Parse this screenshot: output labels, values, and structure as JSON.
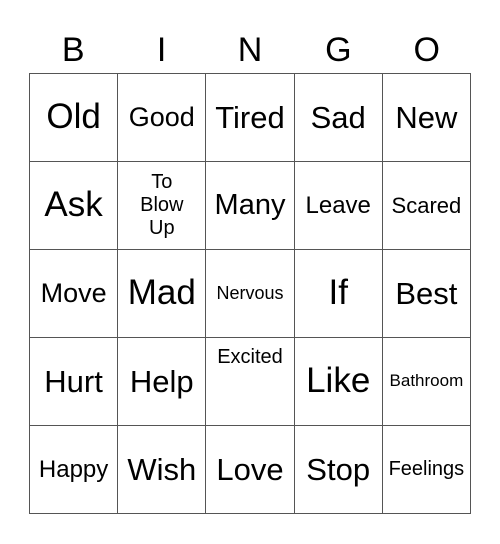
{
  "header": [
    "B",
    "I",
    "N",
    "G",
    "O"
  ],
  "cells": [
    [
      "Old",
      "Good",
      "Tired",
      "Sad",
      "New"
    ],
    [
      "Ask",
      "To\nBlow\nUp",
      "Many",
      "Leave",
      "Scared"
    ],
    [
      "Move",
      "Mad",
      "Nervous",
      "If",
      "Best"
    ],
    [
      "Hurt",
      "Help",
      "Excited",
      "Like",
      "Bathroom"
    ],
    [
      "Happy",
      "Wish",
      "Love",
      "Stop",
      "Feelings"
    ]
  ]
}
